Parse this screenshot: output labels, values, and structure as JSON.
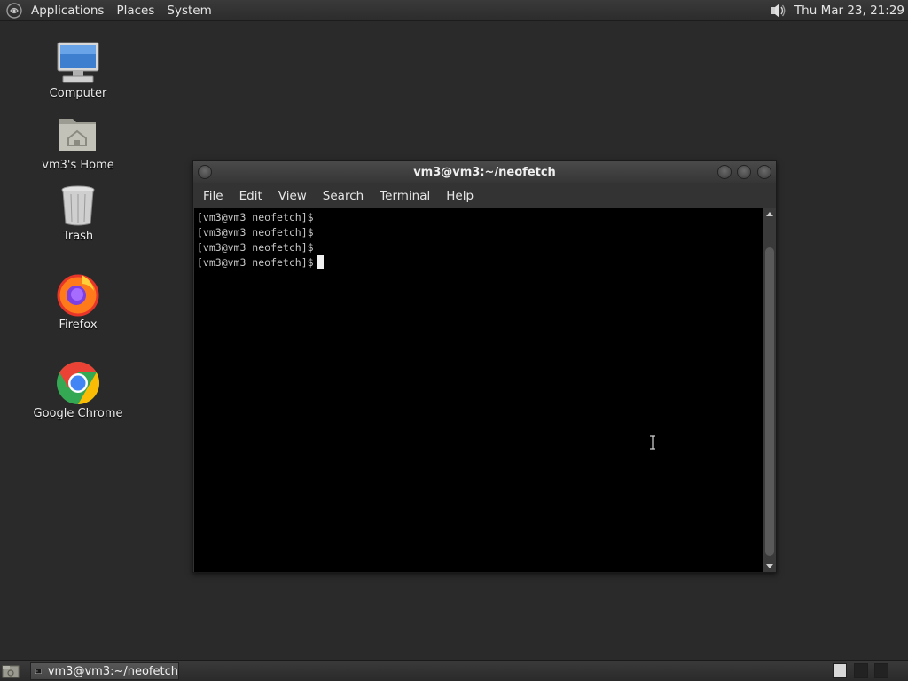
{
  "top_panel": {
    "menus": [
      "Applications",
      "Places",
      "System"
    ],
    "clock": "Thu Mar 23, 21:29",
    "logo_icon": "mate-logo-icon",
    "sound_icon": "speaker-icon"
  },
  "desktop_icons": [
    {
      "label": "Computer",
      "icon": "computer-icon"
    },
    {
      "label": "vm3's Home",
      "icon": "home-folder-icon"
    },
    {
      "label": "Trash",
      "icon": "trash-icon"
    },
    {
      "label": "Firefox",
      "icon": "firefox-icon"
    },
    {
      "label": "Google Chrome",
      "icon": "chrome-icon"
    }
  ],
  "window": {
    "title": "vm3@vm3:~/neofetch",
    "menu": [
      "File",
      "Edit",
      "View",
      "Search",
      "Terminal",
      "Help"
    ],
    "lines": [
      "[vm3@vm3 neofetch]$",
      "[vm3@vm3 neofetch]$",
      "[vm3@vm3 neofetch]$",
      "[vm3@vm3 neofetch]$"
    ]
  },
  "bottom_panel": {
    "task_label": "vm3@vm3:~/neofetch",
    "workspaces": 3,
    "active_workspace": 1
  },
  "colors": {
    "desktop_bg": "#2a2a2a",
    "panel_bg": "#333333",
    "terminal_bg": "#000000",
    "terminal_fg": "#c6c6c6"
  }
}
